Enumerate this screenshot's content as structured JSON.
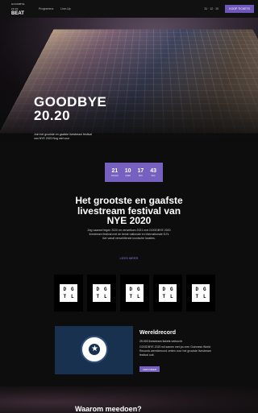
{
  "header": {
    "logo_small": "GOODBYE 20.20",
    "logo_big": "BEAT",
    "nav": [
      "Programma",
      "Line-Up"
    ],
    "date": "31 · 12 · 20",
    "cta": "KOOP TICKETS"
  },
  "hero": {
    "title_line1": "GOODBYE",
    "title_line2": "20.20",
    "text": "Join het grootste en gaafste livestream festival van NYE 2020 Nog niet voor"
  },
  "countdown": [
    {
      "value": "21",
      "label": "DAGEN"
    },
    {
      "value": "10",
      "label": "UREN"
    },
    {
      "value": "17",
      "label": "MIN"
    },
    {
      "value": "43",
      "label": "SEC"
    }
  ],
  "festival": {
    "title": "Het grootste en gaafste livestream festival van NYE 2020",
    "description": "Zeg vaarwel tegen 2020 en verwelkom 2021 met GOODBYE 2020 livestream festival met de beste nationale en internationale DJ's live vanaf verschillende iconische locaties.",
    "link": "LEES MEER"
  },
  "partner_logos": [
    {
      "letters": [
        "D",
        "G",
        "T",
        "L"
      ]
    },
    {
      "letters": [
        "D",
        "G",
        "T",
        "L"
      ]
    },
    {
      "letters": [
        "D",
        "G",
        "T",
        "L"
      ]
    },
    {
      "letters": [
        "D",
        "G",
        "T",
        "L"
      ]
    },
    {
      "letters": [
        "D",
        "G",
        "T",
        "L"
      ]
    }
  ],
  "record": {
    "title": "Wereldrecord",
    "subtitle": "25.000 livestream tickets verkocht",
    "text": "GOODBYE 2020 wil samen met jou een Guinness World Records wereldrecord zetten voor het grootste livestream festival ooit.",
    "button": "LEES MEER",
    "seal_text": "GUINNESS WORLD RECORDS"
  },
  "bottom": {
    "title": "Waarom meedoen?"
  },
  "colors": {
    "accent": "#7661c0",
    "background": "#0d0d0d"
  }
}
